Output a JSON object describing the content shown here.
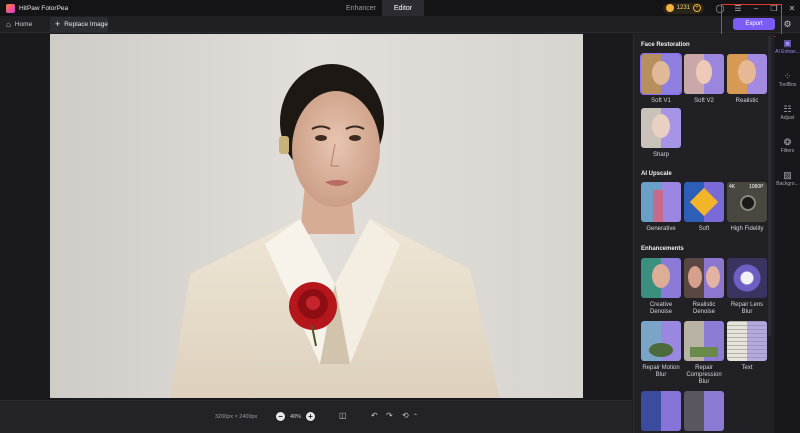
{
  "app": {
    "name": "HitPaw FotorPea"
  },
  "mode_tabs": [
    {
      "label": "Enhancer"
    },
    {
      "label": "Editor"
    }
  ],
  "credits": {
    "count": "1231"
  },
  "subbar": {
    "home_label": "Home",
    "replace_label": "Replace Image",
    "export_label": "Export"
  },
  "bottombar": {
    "dimensions": "3200px × 2400px",
    "zoom": "40%"
  },
  "panel": {
    "face_restoration": {
      "title": "Face Restoration",
      "items": [
        {
          "label": "Soft V1"
        },
        {
          "label": "Soft V2"
        },
        {
          "label": "Realistic"
        },
        {
          "label": "Sharp"
        }
      ]
    },
    "ai_upscale": {
      "title": "AI Upscale",
      "items": [
        {
          "label": "Generative"
        },
        {
          "label": "Soft"
        },
        {
          "label": "High Fidelity"
        }
      ],
      "badges": [
        "4K",
        "1080P"
      ]
    },
    "enhancements": {
      "title": "Enhancements",
      "items": [
        {
          "label": "Creative Denoise"
        },
        {
          "label": "Realistic Denoise"
        },
        {
          "label": "Repair Lens Blur"
        },
        {
          "label": "Repair Motion Blur"
        },
        {
          "label": "Repair Compression Blur"
        },
        {
          "label": "Text"
        }
      ]
    }
  },
  "rail": [
    {
      "label": "AI Enhan..."
    },
    {
      "label": "ToolBox"
    },
    {
      "label": "Adjust"
    },
    {
      "label": "Filters"
    },
    {
      "label": "Backgro..."
    }
  ],
  "colors": {
    "accent": "#7b5cf6",
    "highlight": "#e3392f",
    "coin": "#f4b63a"
  }
}
